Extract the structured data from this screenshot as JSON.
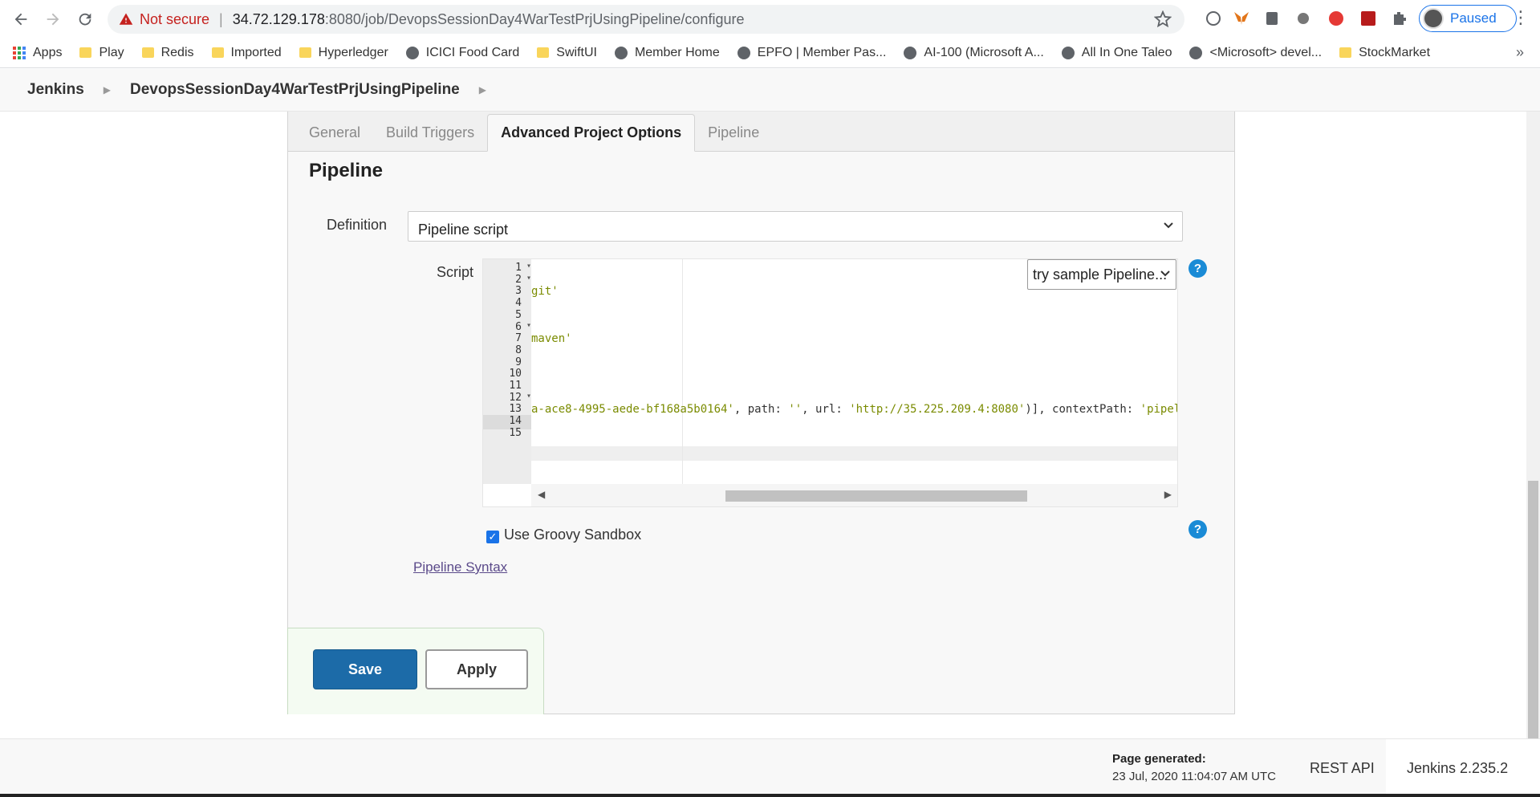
{
  "browser": {
    "security_label": "Not secure",
    "url_host": "34.72.129.178",
    "url_rest": ":8080/job/DevopsSessionDay4WarTestPrjUsingPipeline/configure",
    "profile_label": "Paused"
  },
  "bookmarks": [
    {
      "label": "Apps",
      "icon": "apps-grid-icon"
    },
    {
      "label": "Play",
      "icon": "folder-icon"
    },
    {
      "label": "Redis",
      "icon": "folder-icon"
    },
    {
      "label": "Imported",
      "icon": "folder-icon"
    },
    {
      "label": "Hyperledger",
      "icon": "folder-icon"
    },
    {
      "label": "ICICI Food Card",
      "icon": "globe-icon"
    },
    {
      "label": "SwiftUI",
      "icon": "folder-icon"
    },
    {
      "label": "Member Home",
      "icon": "globe-icon"
    },
    {
      "label": "EPFO | Member Pas...",
      "icon": "globe-icon"
    },
    {
      "label": "AI-100 (Microsoft A...",
      "icon": "globe-icon"
    },
    {
      "label": "All In One Taleo",
      "icon": "globe-icon"
    },
    {
      "label": "<Microsoft> devel...",
      "icon": "globe-icon"
    },
    {
      "label": "StockMarket",
      "icon": "folder-icon"
    }
  ],
  "jenkins": {
    "brand": "Jenkins",
    "job_name": "DevopsSessionDay4WarTestPrjUsingPipeline"
  },
  "tabs": [
    {
      "label": "General",
      "active": false
    },
    {
      "label": "Build Triggers",
      "active": false
    },
    {
      "label": "Advanced Project Options",
      "active": true
    },
    {
      "label": "Pipeline",
      "active": false
    }
  ],
  "pipeline": {
    "section_title": "Pipeline",
    "definition_label": "Definition",
    "definition_value": "Pipeline script",
    "script_label": "Script",
    "sample_select": "try sample Pipeline...",
    "code_lines": [
      {
        "n": "1",
        "text": ""
      },
      {
        "n": "2",
        "text": ""
      },
      {
        "n": "3",
        "text": "git'"
      },
      {
        "n": "4",
        "text": ""
      },
      {
        "n": "5",
        "text": ""
      },
      {
        "n": "6",
        "text": ""
      },
      {
        "n": "7",
        "text": "maven'"
      },
      {
        "n": "8",
        "text": ""
      },
      {
        "n": "9",
        "text": ""
      },
      {
        "n": "10",
        "text": ""
      },
      {
        "n": "11",
        "text": ""
      },
      {
        "n": "12",
        "text": ""
      },
      {
        "n": "13",
        "text": "a-ace8-4995-aede-bf168a5b0164', path: '', url: 'http://35.225.209.4:8080')], contextPath: 'pipelin"
      },
      {
        "n": "14",
        "text": ""
      },
      {
        "n": "15",
        "text": ""
      }
    ],
    "sandbox_label": "Use Groovy Sandbox",
    "sandbox_checked": true,
    "syntax_link": "Pipeline Syntax",
    "save_label": "Save",
    "apply_label": "Apply"
  },
  "footer": {
    "page_generated_label": "Page generated:",
    "page_generated_date": "23 Jul, 2020 11:04:07 AM UTC",
    "rest_api": "REST API",
    "version": "Jenkins 2.235.2"
  }
}
